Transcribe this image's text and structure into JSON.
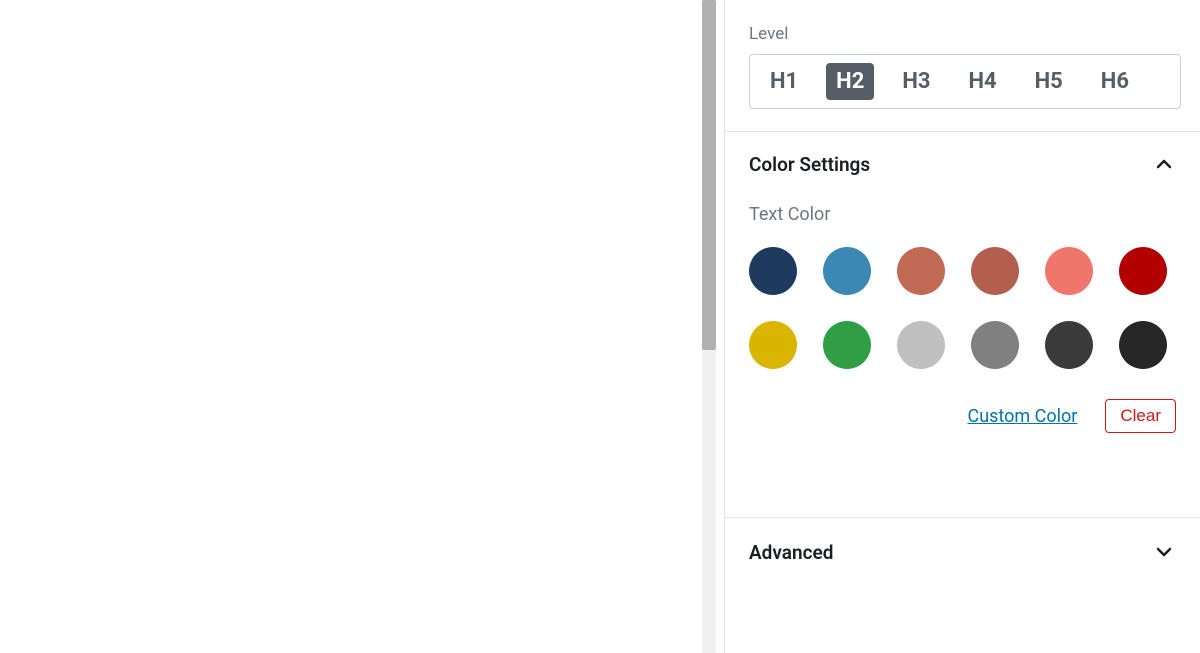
{
  "level": {
    "label": "Level",
    "options": [
      "H1",
      "H2",
      "H3",
      "H4",
      "H5",
      "H6"
    ],
    "selected": "H2"
  },
  "color_panel": {
    "title": "Color Settings",
    "expanded": true,
    "text_color_label": "Text Color",
    "swatches": [
      "#1e3a5f",
      "#3a88b3",
      "#c06a55",
      "#b35f50",
      "#f0766b",
      "#b20000",
      "#d9b500",
      "#2f9e44",
      "#c0c0c0",
      "#808080",
      "#3a3a3a",
      "#262626"
    ],
    "custom_color_label": "Custom Color",
    "clear_label": "Clear"
  },
  "advanced_panel": {
    "title": "Advanced",
    "expanded": false
  }
}
